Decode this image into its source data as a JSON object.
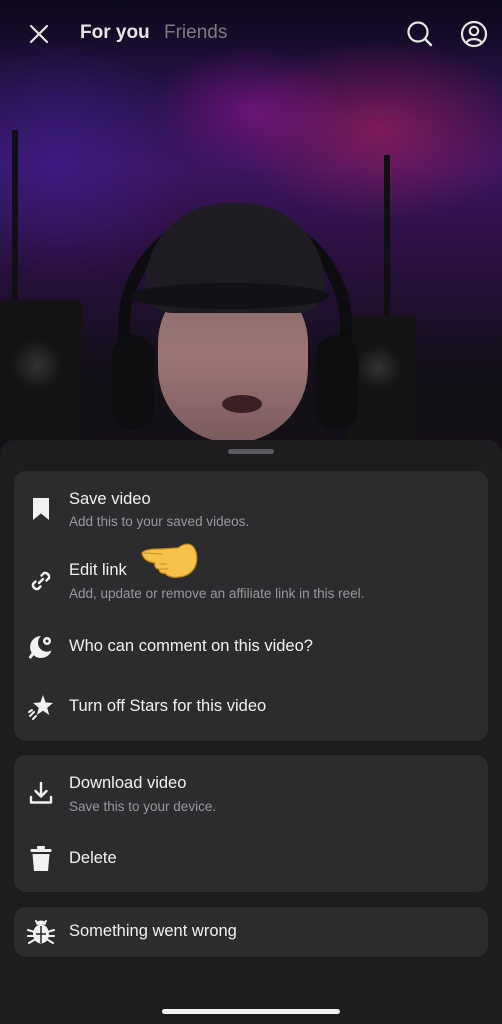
{
  "header": {
    "close_icon": "close-icon",
    "tabs": [
      {
        "label": "For you",
        "active": true
      },
      {
        "label": "Friends",
        "active": false
      }
    ],
    "search_icon": "search-icon",
    "profile_icon": "profile-icon"
  },
  "sheet": {
    "group1": [
      {
        "icon": "bookmark-icon",
        "title": "Save video",
        "subtitle": "Add this to your saved videos."
      },
      {
        "icon": "link-icon",
        "title": "Edit link",
        "subtitle": "Add, update or remove an affiliate link in this reel."
      },
      {
        "icon": "comment-settings-icon",
        "title": "Who can comment on this video?"
      },
      {
        "icon": "stars-icon",
        "title": "Turn off Stars for this video"
      }
    ],
    "group2": [
      {
        "icon": "download-icon",
        "title": "Download video",
        "subtitle": "Save this to your device."
      },
      {
        "icon": "trash-icon",
        "title": "Delete"
      }
    ],
    "group3": [
      {
        "icon": "bug-icon",
        "title": "Something went wrong"
      }
    ]
  },
  "colors": {
    "sheet_bg": "#1d1d1f",
    "group_bg": "#2c2c2e",
    "text_primary": "#f2f2f2",
    "text_secondary": "#9a9a9e"
  }
}
